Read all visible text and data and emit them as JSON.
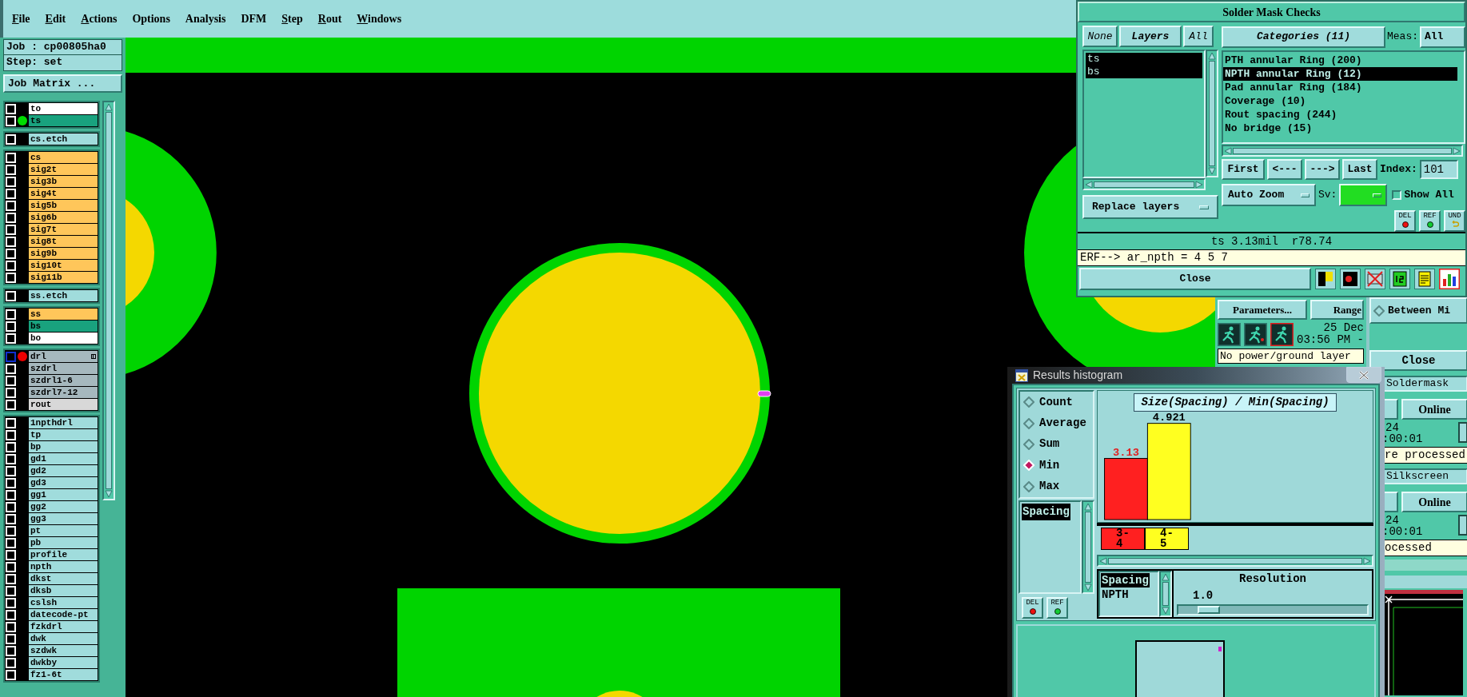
{
  "menu": [
    {
      "label": "File",
      "underline": true
    },
    {
      "label": "Edit",
      "underline": true
    },
    {
      "label": "Actions",
      "underline": true
    },
    {
      "label": "Options",
      "underline": false
    },
    {
      "label": "Analysis",
      "underline": false
    },
    {
      "label": "DFM",
      "underline": false
    },
    {
      "label": "Step",
      "underline": true
    },
    {
      "label": "Rout",
      "underline": true
    },
    {
      "label": "Windows",
      "underline": true
    }
  ],
  "job": {
    "job_label": "Job : cp00805ha0",
    "step_label": "Step: set",
    "matrix_button": "Job Matrix ..."
  },
  "layer_groups": [
    {
      "layers": [
        {
          "name": "to",
          "color": "#ffffff",
          "focused": false,
          "linked": false
        },
        {
          "name": "ts",
          "color": "#19a27e",
          "focused": false,
          "linked": false,
          "dot": {
            "color": "#00dd00"
          }
        }
      ]
    },
    {
      "layers": [
        {
          "name": "cs.etch",
          "color": "#a0dcdc",
          "focused": false,
          "linked": false
        }
      ]
    },
    {
      "layers": [
        {
          "name": "cs",
          "color": "#ffc65a",
          "focused": false,
          "linked": false
        },
        {
          "name": "sig2t",
          "color": "#ffc65a",
          "focused": false,
          "linked": false
        },
        {
          "name": "sig3b",
          "color": "#ffc65a",
          "focused": false,
          "linked": false
        },
        {
          "name": "sig4t",
          "color": "#ffc65a",
          "focused": false,
          "linked": false
        },
        {
          "name": "sig5b",
          "color": "#ffc65a",
          "focused": false,
          "linked": false
        },
        {
          "name": "sig6b",
          "color": "#ffc65a",
          "focused": false,
          "linked": false
        },
        {
          "name": "sig7t",
          "color": "#ffc65a",
          "focused": false,
          "linked": false
        },
        {
          "name": "sig8t",
          "color": "#ffc65a",
          "focused": false,
          "linked": false
        },
        {
          "name": "sig9b",
          "color": "#ffc65a",
          "focused": false,
          "linked": false
        },
        {
          "name": "sig10t",
          "color": "#ffc65a",
          "focused": false,
          "linked": false
        },
        {
          "name": "sig11b",
          "color": "#ffc65a",
          "focused": false,
          "linked": false
        }
      ]
    },
    {
      "layers": [
        {
          "name": "ss.etch",
          "color": "#a0dcdc",
          "focused": false,
          "linked": false
        }
      ]
    },
    {
      "layers": [
        {
          "name": "ss",
          "color": "#ffc65a",
          "focused": false,
          "linked": false
        },
        {
          "name": "bs",
          "color": "#19a27e",
          "focused": false,
          "linked": false
        },
        {
          "name": "bo",
          "color": "#ffffff",
          "focused": false,
          "linked": false
        }
      ]
    },
    {
      "layers": [
        {
          "name": "drl",
          "color": "#a6b8be",
          "focused": true,
          "linked": true,
          "dot": {
            "color": "#ee0000"
          }
        },
        {
          "name": "szdrl",
          "color": "#a6b8be",
          "focused": false,
          "linked": false
        },
        {
          "name": "szdrl1-6",
          "color": "#a6b8be",
          "focused": false,
          "linked": false
        },
        {
          "name": "szdrl7-12",
          "color": "#a6b8be",
          "focused": false,
          "linked": false
        },
        {
          "name": "rout",
          "color": "#d8d8d8",
          "focused": false,
          "linked": false
        }
      ]
    },
    {
      "layers": [
        {
          "name": "1npthdrl",
          "color": "#a0dcdc",
          "focused": false,
          "linked": false
        },
        {
          "name": "tp",
          "color": "#a0dcdc",
          "focused": false,
          "linked": false
        },
        {
          "name": "bp",
          "color": "#a0dcdc",
          "focused": false,
          "linked": false
        },
        {
          "name": "gd1",
          "color": "#a0dcdc",
          "focused": false,
          "linked": false
        },
        {
          "name": "gd2",
          "color": "#a0dcdc",
          "focused": false,
          "linked": false
        },
        {
          "name": "gd3",
          "color": "#a0dcdc",
          "focused": false,
          "linked": false
        },
        {
          "name": "gg1",
          "color": "#a0dcdc",
          "focused": false,
          "linked": false
        },
        {
          "name": "gg2",
          "color": "#a0dcdc",
          "focused": false,
          "linked": false
        },
        {
          "name": "gg3",
          "color": "#a0dcdc",
          "focused": false,
          "linked": false
        },
        {
          "name": "pt",
          "color": "#a0dcdc",
          "focused": false,
          "linked": false
        },
        {
          "name": "pb",
          "color": "#a0dcdc",
          "focused": false,
          "linked": false
        },
        {
          "name": "profile",
          "color": "#a0dcdc",
          "focused": false,
          "linked": false
        },
        {
          "name": "npth",
          "color": "#a0dcdc",
          "focused": false,
          "linked": false
        },
        {
          "name": "dkst",
          "color": "#a0dcdc",
          "focused": false,
          "linked": false
        },
        {
          "name": "dksb",
          "color": "#a0dcdc",
          "focused": false,
          "linked": false
        },
        {
          "name": "cslsh",
          "color": "#a0dcdc",
          "focused": false,
          "linked": false
        },
        {
          "name": "datecode-pt",
          "color": "#a0dcdc",
          "focused": false,
          "linked": false
        },
        {
          "name": "fzkdrl",
          "color": "#a0dcdc",
          "focused": false,
          "linked": false
        },
        {
          "name": "dwk",
          "color": "#a0dcdc",
          "focused": false,
          "linked": false
        },
        {
          "name": "szdwk",
          "color": "#a0dcdc",
          "focused": false,
          "linked": false
        },
        {
          "name": "dwkby",
          "color": "#a0dcdc",
          "focused": false,
          "linked": false
        },
        {
          "name": "fz1-6t",
          "color": "#a0dcdc",
          "focused": false,
          "linked": false
        }
      ]
    }
  ],
  "solder_mask": {
    "title": "Solder Mask Checks",
    "layer_buttons": [
      "None",
      "Layers",
      "All"
    ],
    "layers": [
      {
        "name": "ts",
        "selected": true
      },
      {
        "name": "bs",
        "selected": true
      }
    ],
    "replace_button": "Replace layers",
    "categories_button": "Categories (11)",
    "meas_label": "Meas:",
    "meas_value": "All",
    "categories": [
      {
        "label": "PTH annular Ring (200)",
        "selected": false
      },
      {
        "label": "NPTH annular Ring (12)",
        "selected": true
      },
      {
        "label": "Pad annular Ring (184)",
        "selected": false
      },
      {
        "label": "Coverage (10)",
        "selected": false
      },
      {
        "label": "Rout spacing (244)",
        "selected": false
      },
      {
        "label": "No bridge (15)",
        "selected": false
      }
    ],
    "nav_buttons": [
      "First",
      "<---",
      "--->",
      "Last"
    ],
    "index_label": "Index:",
    "index_value": "101",
    "zoom_mode": "Auto Zoom",
    "sv_label": "Sv:",
    "show_all": {
      "label": "Show All",
      "checked": false
    },
    "tool_buttons": [
      {
        "label": "DEL",
        "kind": "delete"
      },
      {
        "label": "REF",
        "kind": "refresh"
      },
      {
        "label": "UND",
        "kind": "undo"
      }
    ],
    "status": "ts 3.13mil  r78.74",
    "command": "ERF--> ar_npth = 4 5 7",
    "close_button": "Close"
  },
  "analysis_window": {
    "parameters_button": "Parameters...",
    "ranges_button": "Range",
    "date": "25 Dec",
    "time": "03:56 PM -",
    "message": "No power/ground layer",
    "mode": {
      "label": "Between Mi",
      "selected": false
    },
    "close_button": "Close",
    "entries": [
      {
        "name": "Soldermask",
        "button": "Online",
        "count": "24",
        "duration": ":00:01",
        "status": "re processed"
      },
      {
        "name": "Silkscreen",
        "button": "Online",
        "count": "24",
        "duration": ":00:01",
        "status": "ocessed"
      }
    ]
  },
  "histogram": {
    "title": "Results histogram",
    "modes": [
      {
        "label": "Count",
        "selected": false
      },
      {
        "label": "Average",
        "selected": false
      },
      {
        "label": "Sum",
        "selected": false
      },
      {
        "label": "Min",
        "selected": true
      },
      {
        "label": "Max",
        "selected": false
      }
    ],
    "measures": [
      {
        "label": "Spacing",
        "selected": true
      }
    ],
    "tool_buttons": [
      {
        "label": "DEL",
        "kind": "delete"
      },
      {
        "label": "REF",
        "kind": "refresh"
      }
    ],
    "chart_data": {
      "type": "bar",
      "title": "Size(Spacing) / Min(Spacing)",
      "categories": [
        "3-4",
        "4-5"
      ],
      "stacked": true,
      "data_labels": true,
      "series": [
        {
          "color": "#ff2020",
          "values": [
            3.13,
            null
          ]
        },
        {
          "color": "#ffff20",
          "values": [
            null,
            4.921
          ]
        }
      ]
    },
    "filters": [
      {
        "label": "Spacing",
        "selected": true
      },
      {
        "label": "NPTH",
        "selected": false
      }
    ],
    "resolution": {
      "label": "Resolution",
      "value": "1.0",
      "level": 0.1
    }
  }
}
